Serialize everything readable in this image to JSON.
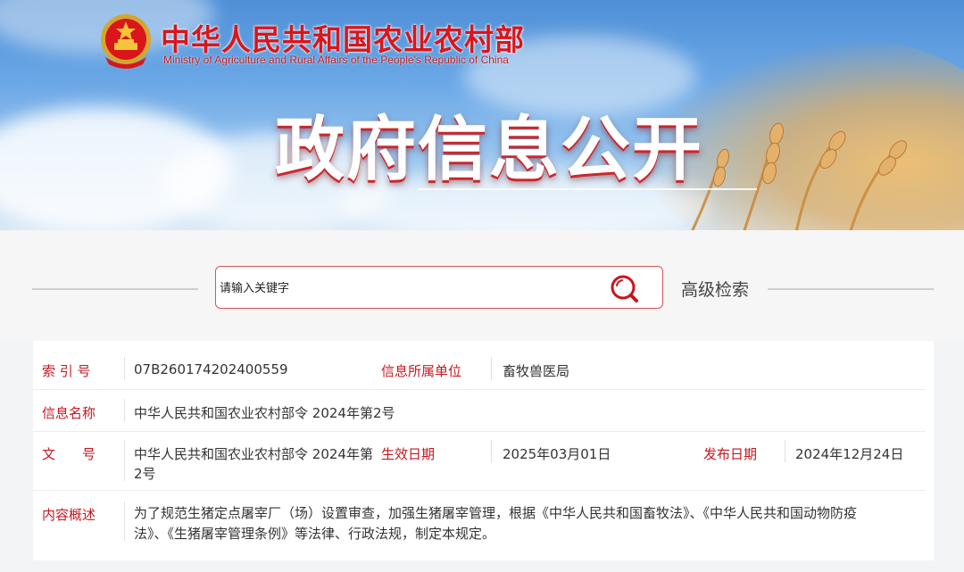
{
  "header": {
    "site_name_cn": "中华人民共和国农业农村部",
    "site_name_en": "Ministry of Agriculture and Rural Affairs of the People's Republic of China",
    "banner_title": "政府信息公开",
    "emblem_icon": "national-emblem-icon"
  },
  "search": {
    "placeholder": "请输入关键字",
    "search_icon": "search-icon",
    "advanced_label": "高级检索",
    "accent_color": "#d7525a"
  },
  "info": {
    "index_label": "索 引 号",
    "index_value": "07B260174202400559",
    "unit_label": "信息所属单位",
    "unit_value": "畜牧兽医局",
    "name_label": "信息名称",
    "name_value": "中华人民共和国农业农村部令 2024年第2号",
    "doc_label": "文　　号",
    "doc_value_line1": "中华人民共和国农业农村部令 2024年第",
    "doc_value_line2": "2号",
    "effective_label": "生效日期",
    "effective_value": "2025年03月01日",
    "publish_label": "发布日期",
    "publish_value": "2024年12月24日",
    "summary_label": "内容概述",
    "summary_line1": "为了规范生猪定点屠宰厂（场）设置审查，加强生猪屠宰管理，根据《中华人民共和国畜牧法》、《中华人民共和国动物防疫",
    "summary_line2": "法》、《生猪屠宰管理条例》等法律、行政法规，制定本规定。",
    "label_color": "#c7161e"
  }
}
